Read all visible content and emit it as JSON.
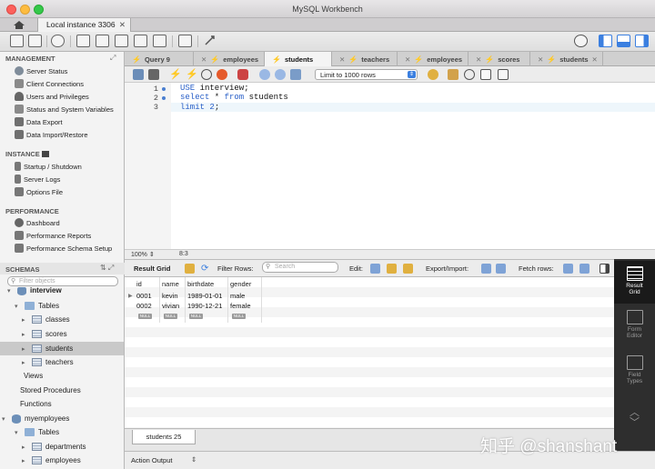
{
  "window": {
    "title": "MySQL Workbench"
  },
  "connection_tab": {
    "label": "Local instance 3306"
  },
  "sidebar": {
    "management": {
      "title": "MANAGEMENT",
      "items": [
        "Server Status",
        "Client Connections",
        "Users and Privileges",
        "Status and System Variables",
        "Data Export",
        "Data Import/Restore"
      ]
    },
    "instance": {
      "title": "INSTANCE",
      "items": [
        "Startup / Shutdown",
        "Server Logs",
        "Options File"
      ]
    },
    "performance": {
      "title": "PERFORMANCE",
      "items": [
        "Dashboard",
        "Performance Reports",
        "Performance Schema Setup"
      ]
    },
    "schemas": {
      "title": "SCHEMAS",
      "filter_placeholder": "Filter objects"
    },
    "tree": {
      "db1": "interview",
      "tables": "Tables",
      "tables_list": [
        "classes",
        "scores",
        "students",
        "teachers"
      ],
      "views": "Views",
      "stored_procedures": "Stored Procedures",
      "functions": "Functions",
      "db2": "myemployees",
      "tables2": "Tables",
      "tables2_list": [
        "departments",
        "employees"
      ]
    }
  },
  "editor_tabs": [
    "Query 9",
    "employees",
    "students",
    "teachers",
    "employees",
    "scores",
    "students"
  ],
  "active_editor_tab": 2,
  "query_toolbar": {
    "limit": "Limit to 1000 rows"
  },
  "code": {
    "line_numbers": [
      "1",
      "2",
      "3"
    ],
    "l1": {
      "kw": "USE",
      "rest": " interview;"
    },
    "l2": {
      "kw1": "select",
      "mid": " * ",
      "kw2": "from",
      "rest": " students"
    },
    "l3": {
      "kw": "limit",
      "num": "2",
      "end": ";"
    }
  },
  "status": {
    "zoom": "100%",
    "position": "8:3"
  },
  "result_toolbar": {
    "result_grid": "Result Grid",
    "filter_rows": "Filter Rows:",
    "search_placeholder": "Search",
    "edit": "Edit:",
    "export_import": "Export/Import:",
    "fetch_rows": "Fetch rows:"
  },
  "grid": {
    "columns": [
      "id",
      "name",
      "birthdate",
      "gender"
    ],
    "rows": [
      [
        "0001",
        "kevin",
        "1989-01-01",
        "male"
      ],
      [
        "0002",
        "vivian",
        "1990-12-21",
        "female"
      ]
    ],
    "null_label": "NULL"
  },
  "result_tab": {
    "label": "students 25"
  },
  "output": {
    "label": "Action Output"
  },
  "right_panel": {
    "result_grid": [
      "Result",
      "Grid"
    ],
    "form_editor": [
      "Form",
      "Editor"
    ],
    "field_types": [
      "Field",
      "Types"
    ]
  },
  "watermark": "知乎 @shanshant",
  "colors": {
    "accent": "#3b7fe0",
    "selected_row": "#c9c9c9",
    "dark_panel": "#2e2e2e"
  }
}
